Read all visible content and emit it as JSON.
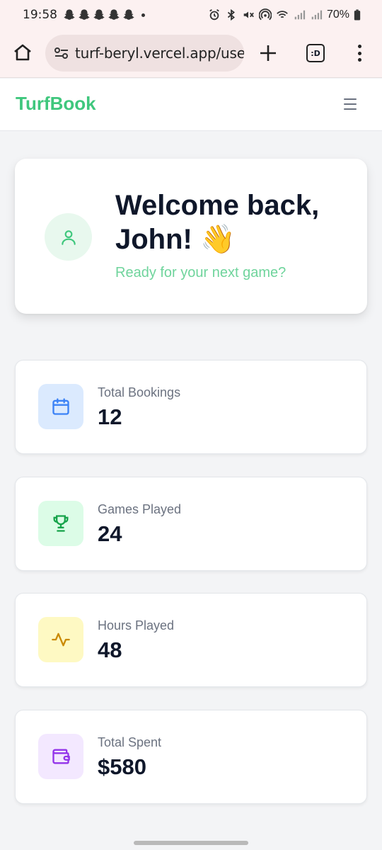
{
  "status_bar": {
    "time": "19:58",
    "battery": "70%",
    "notification_icons": [
      "snapchat-icon",
      "snapchat-icon",
      "snapchat-icon",
      "snapchat-icon",
      "snapchat-icon"
    ]
  },
  "browser": {
    "url": "turf-beryl.vercel.app/use",
    "tabs_label": ":D"
  },
  "app": {
    "brand": "TurfBook",
    "brand_color": "#3fc77d"
  },
  "welcome": {
    "title": "Welcome back, John! 👋",
    "subtitle": "Ready for your next game?"
  },
  "stats": [
    {
      "label": "Total Bookings",
      "value": "12",
      "icon": "calendar-icon",
      "icon_bg": "#dbeafe",
      "icon_color": "#3b82f6"
    },
    {
      "label": "Games Played",
      "value": "24",
      "icon": "trophy-icon",
      "icon_bg": "#dcfce7",
      "icon_color": "#16a34a"
    },
    {
      "label": "Hours Played",
      "value": "48",
      "icon": "activity-icon",
      "icon_bg": "#fef9c3",
      "icon_color": "#ca8a04"
    },
    {
      "label": "Total Spent",
      "value": "$580",
      "icon": "wallet-icon",
      "icon_bg": "#f3e8ff",
      "icon_color": "#9333ea"
    }
  ]
}
